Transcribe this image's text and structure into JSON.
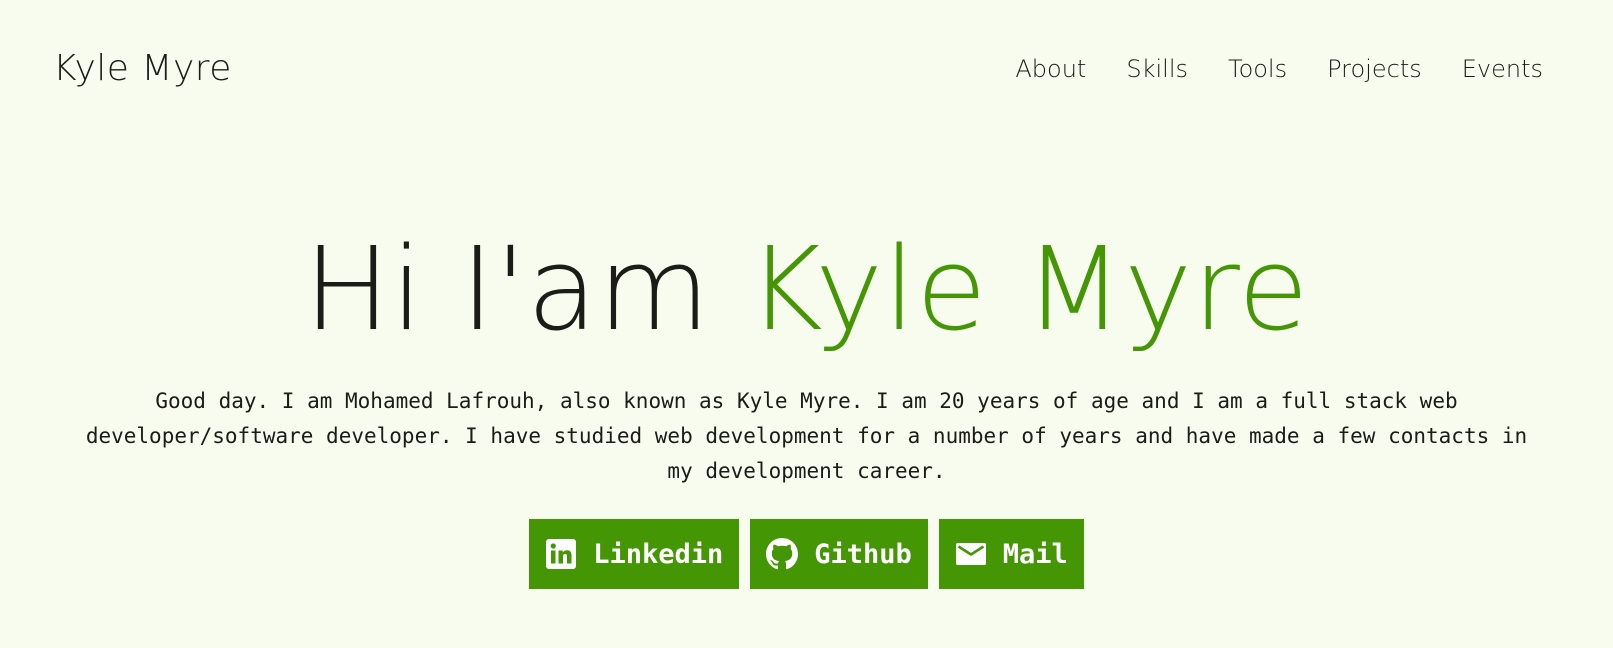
{
  "site": {
    "logo": "Kyle Myre"
  },
  "nav": {
    "items": [
      {
        "label": "About"
      },
      {
        "label": "Skills"
      },
      {
        "label": "Tools"
      },
      {
        "label": "Projects"
      },
      {
        "label": "Events"
      }
    ]
  },
  "hero": {
    "title_prefix": "Hi I'am ",
    "title_name": "Kyle Myre",
    "intro": "Good day. I am Mohamed Lafrouh, also known as Kyle Myre. I am 20 years of age and I am a full stack web developer/software developer. I have studied web development for a number of years and have made a few contacts in my development career."
  },
  "buttons": [
    {
      "label": "Linkedin",
      "icon": "linkedin-icon"
    },
    {
      "label": "Github",
      "icon": "github-icon"
    },
    {
      "label": "Mail",
      "icon": "mail-icon"
    }
  ],
  "colors": {
    "background": "#f8fcee",
    "accent": "#449605",
    "text": "#1b1b17",
    "button_text": "#ffffff"
  }
}
